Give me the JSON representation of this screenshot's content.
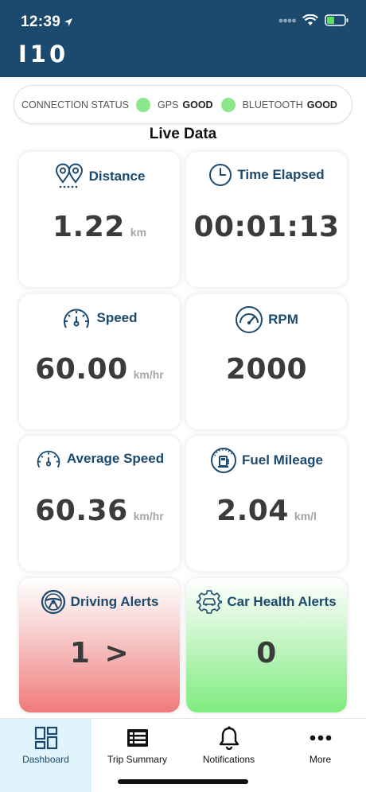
{
  "status_bar": {
    "time": "12:39"
  },
  "header": {
    "title": "I10"
  },
  "connection": {
    "label": "CONNECTION STATUS",
    "gps": {
      "name": "GPS",
      "status": "GOOD",
      "color": "#8de88d"
    },
    "bluetooth": {
      "name": "BLUETOOTH",
      "status": "GOOD",
      "color": "#8de88d"
    }
  },
  "section_title": "Live Data",
  "cards": {
    "distance": {
      "label": "Distance",
      "value": "1.22",
      "unit": "km",
      "icon": "map-pins-icon"
    },
    "time_elapsed": {
      "label": "Time Elapsed",
      "value": "00:01:13",
      "icon": "clock-icon"
    },
    "speed": {
      "label": "Speed",
      "value": "60.00",
      "unit": "km/hr",
      "icon": "speedometer-icon"
    },
    "rpm": {
      "label": "RPM",
      "value": "2000",
      "icon": "gauge-icon"
    },
    "average_speed": {
      "label": "Average Speed",
      "value": "60.36",
      "unit": "km/hr",
      "icon": "speedometer-icon"
    },
    "fuel_mileage": {
      "label": "Fuel Mileage",
      "value": "2.04",
      "unit": "km/l",
      "icon": "fuel-pump-icon"
    },
    "driving_alerts": {
      "label": "Driving Alerts",
      "value": "1",
      "arrow": ">",
      "icon": "steering-wheel-icon"
    },
    "car_health_alerts": {
      "label": "Car Health Alerts",
      "value": "0",
      "icon": "car-gear-icon"
    }
  },
  "tabs": [
    {
      "label": "Dashboard",
      "icon": "dashboard-icon",
      "active": true
    },
    {
      "label": "Trip Summary",
      "icon": "list-icon",
      "active": false
    },
    {
      "label": "Notifications",
      "icon": "bell-icon",
      "active": false
    },
    {
      "label": "More",
      "icon": "more-dots-icon",
      "active": false
    }
  ],
  "colors": {
    "header": "#1c4a6e",
    "accent": "#1c4a6e",
    "status_good": "#8de88d",
    "alert_red": "#f07a7a",
    "alert_green": "#7eec7e",
    "active_tab": "#dff5fb"
  }
}
